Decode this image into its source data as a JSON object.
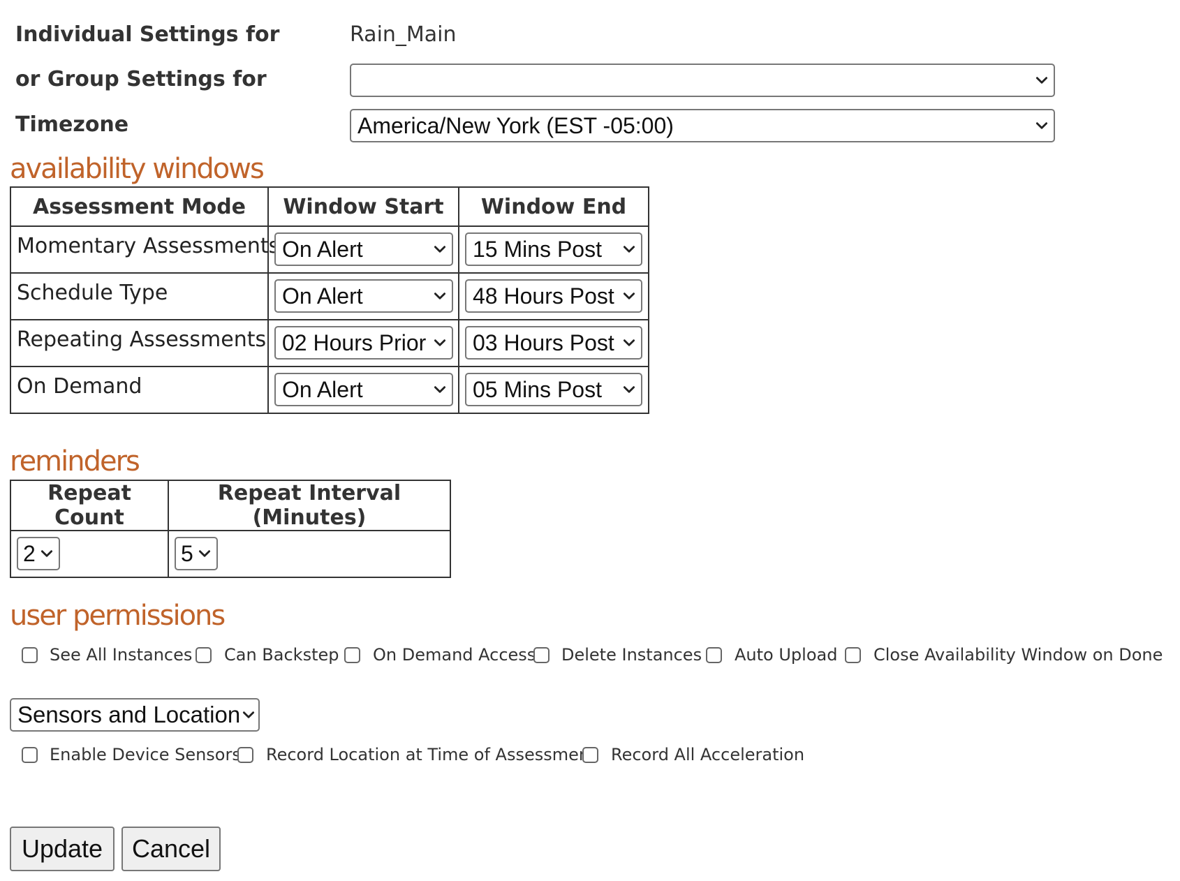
{
  "settings": {
    "individual_label": "Individual Settings for",
    "individual_value": "Rain_Main",
    "group_label": "or Group Settings for",
    "group_value": "",
    "timezone_label": "Timezone",
    "timezone_value": "America/New York (EST -05:00)"
  },
  "availability": {
    "heading": "availability windows",
    "headers": [
      "Assessment Mode",
      "Window Start",
      "Window End"
    ],
    "rows": [
      {
        "mode": "Momentary Assessments",
        "start": "On Alert",
        "end": "15 Mins Post"
      },
      {
        "mode": "Schedule Type",
        "start": "On Alert",
        "end": "48 Hours Post"
      },
      {
        "mode": "Repeating Assessments",
        "start": "02 Hours Prior",
        "end": "03 Hours Post"
      },
      {
        "mode": "On Demand",
        "start": "On Alert",
        "end": "05 Mins Post"
      }
    ]
  },
  "reminders": {
    "heading": "reminders",
    "headers": [
      "Repeat Count",
      "Repeat Interval (Minutes)"
    ],
    "repeat_count": "2",
    "repeat_interval": "5"
  },
  "permissions": {
    "heading": "user permissions",
    "items": [
      {
        "label": "See All Instances",
        "checked": false
      },
      {
        "label": "Can Backstep",
        "checked": false
      },
      {
        "label": "On Demand Access",
        "checked": false
      },
      {
        "label": "Delete Instances",
        "checked": false
      },
      {
        "label": "Auto Upload",
        "checked": false
      },
      {
        "label": "Close Availability Window on Done",
        "checked": false
      }
    ]
  },
  "sensors": {
    "select_value": "Sensors and Location",
    "items": [
      {
        "label": "Enable Device Sensors",
        "checked": false
      },
      {
        "label": "Record Location at Time of Assessment",
        "checked": false
      },
      {
        "label": "Record All Acceleration",
        "checked": false
      }
    ]
  },
  "buttons": {
    "update": "Update",
    "cancel": "Cancel"
  },
  "icons": {
    "dropdown": "chevron-down-icon",
    "checkbox": "checkbox-unchecked"
  }
}
